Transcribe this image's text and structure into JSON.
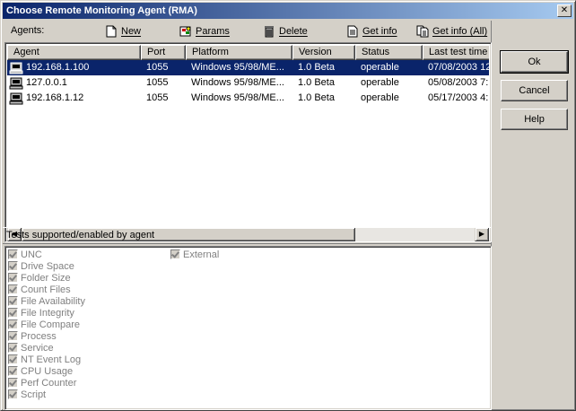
{
  "window": {
    "title": "Choose Remote Monitoring Agent (RMA)",
    "close": "✕"
  },
  "toolbar": {
    "label": "Agents:",
    "buttons": {
      "new": "New",
      "params": "Params",
      "delete": "Delete",
      "get_info": "Get info",
      "get_info_all": "Get info (All)"
    }
  },
  "agents_table": {
    "columns": [
      "Agent",
      "Port",
      "Platform",
      "Version",
      "Status",
      "Last test time"
    ],
    "rows": [
      {
        "agent": "192.168.1.100",
        "port": "1055",
        "platform": "Windows 95/98/ME...",
        "version": "1.0 Beta",
        "status": "operable",
        "last_test": "07/08/2003 12:",
        "selected": true
      },
      {
        "agent": "127.0.0.1",
        "port": "1055",
        "platform": "Windows 95/98/ME...",
        "version": "1.0 Beta",
        "status": "operable",
        "last_test": "05/08/2003 7:",
        "selected": false
      },
      {
        "agent": "192.168.1.12",
        "port": "1055",
        "platform": "Windows 95/98/ME...",
        "version": "1.0 Beta",
        "status": "operable",
        "last_test": "05/17/2003 4:",
        "selected": false
      }
    ]
  },
  "tests": {
    "header": "Tests supported/enabled by agent",
    "col1": [
      "UNC",
      "Drive Space",
      "Folder Size",
      "Count Files",
      "File Availability",
      "File Integrity",
      "File Compare",
      "Process",
      "Service",
      "NT Event Log",
      "CPU Usage",
      "Perf Counter",
      "Script"
    ],
    "col2": [
      "External"
    ]
  },
  "buttons": {
    "ok": "Ok",
    "cancel": "Cancel",
    "help": "Help"
  },
  "colors": {
    "selection": "#0a246a",
    "face": "#d4d0c8",
    "disabled_text": "#808080"
  }
}
